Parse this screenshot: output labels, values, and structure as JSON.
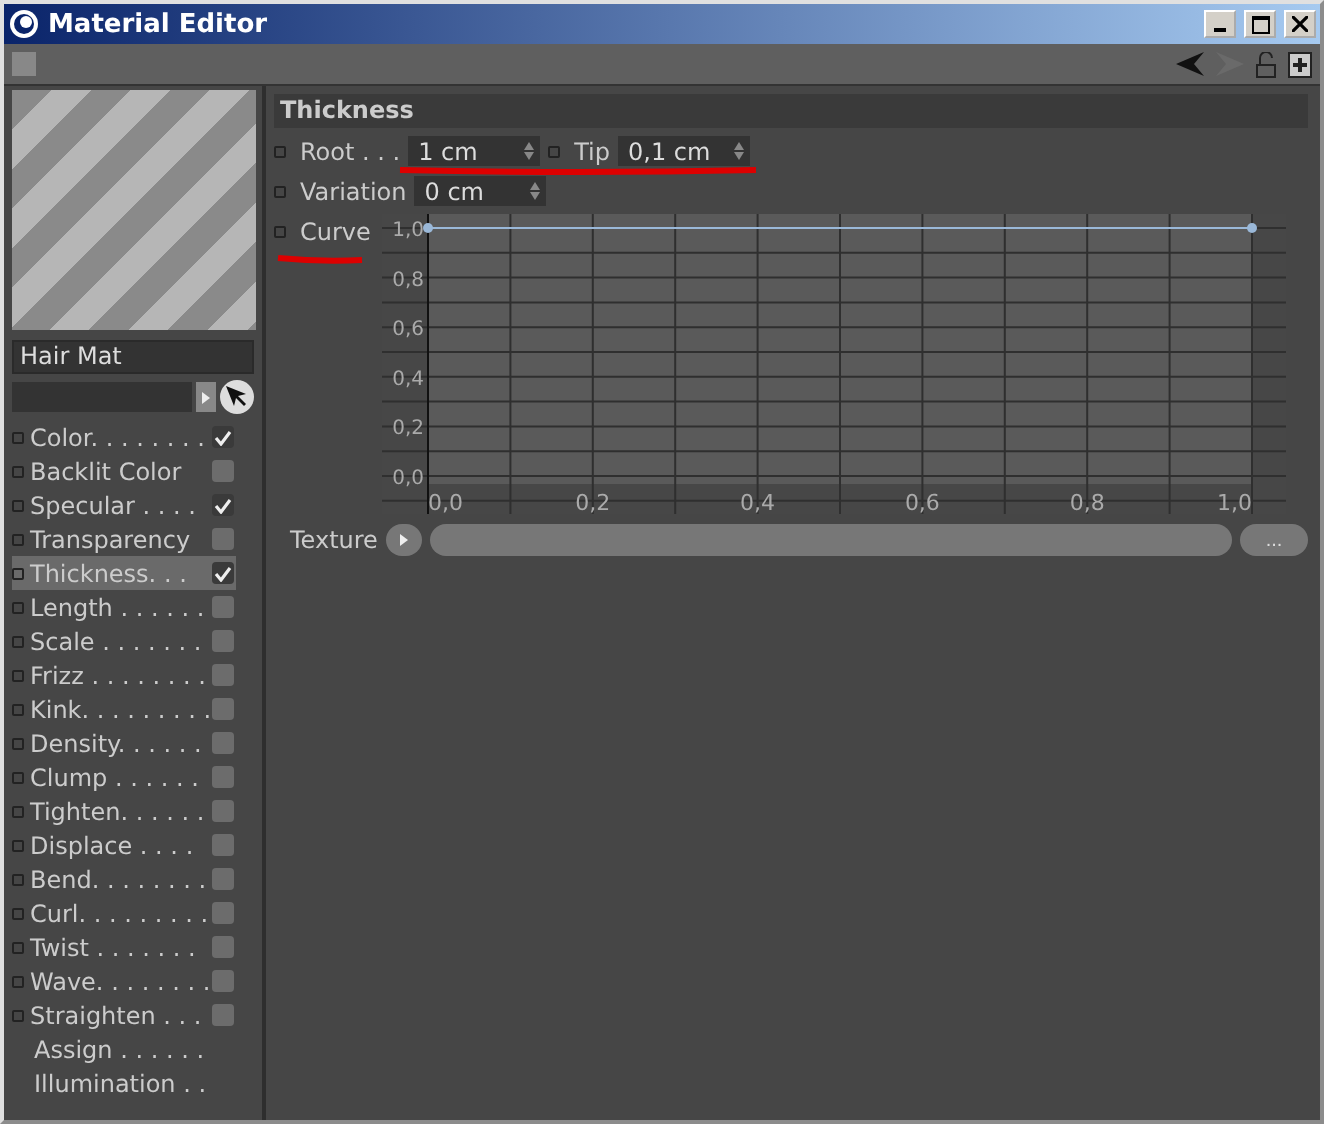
{
  "window": {
    "title": "Material Editor"
  },
  "material_name": "Hair Mat",
  "channels": [
    {
      "kind": "check",
      "label": "Color. . . . . . . .",
      "checked": true,
      "selected": false
    },
    {
      "kind": "check",
      "label": "Backlit Color",
      "checked": false,
      "selected": false
    },
    {
      "kind": "check",
      "label": "Specular . . . .",
      "checked": true,
      "selected": false
    },
    {
      "kind": "check",
      "label": "Transparency",
      "checked": false,
      "selected": false
    },
    {
      "kind": "check",
      "label": "Thickness. . .",
      "checked": true,
      "selected": true
    },
    {
      "kind": "check",
      "label": "Length . . . . . .",
      "checked": false,
      "selected": false
    },
    {
      "kind": "check",
      "label": "Scale . . . . . . .",
      "checked": false,
      "selected": false
    },
    {
      "kind": "check",
      "label": "Frizz . . . . . . . .",
      "checked": false,
      "selected": false
    },
    {
      "kind": "check",
      "label": "Kink. . . . . . . . .",
      "checked": false,
      "selected": false
    },
    {
      "kind": "check",
      "label": "Density. . . . . .",
      "checked": false,
      "selected": false
    },
    {
      "kind": "check",
      "label": "Clump . . . . . .",
      "checked": false,
      "selected": false
    },
    {
      "kind": "check",
      "label": "Tighten. . . . . .",
      "checked": false,
      "selected": false
    },
    {
      "kind": "check",
      "label": "Displace . . . .",
      "checked": false,
      "selected": false
    },
    {
      "kind": "check",
      "label": "Bend. . . . . . . .",
      "checked": false,
      "selected": false
    },
    {
      "kind": "check",
      "label": "Curl. . . . . . . . .",
      "checked": false,
      "selected": false
    },
    {
      "kind": "check",
      "label": "Twist . . . . . . .",
      "checked": false,
      "selected": false
    },
    {
      "kind": "check",
      "label": "Wave. . . . . . . .",
      "checked": false,
      "selected": false
    },
    {
      "kind": "check",
      "label": "Straighten . . .",
      "checked": false,
      "selected": false
    },
    {
      "kind": "plain",
      "label": "Assign . . . . . .",
      "selected": false
    },
    {
      "kind": "plain",
      "label": "Illumination . .",
      "selected": false
    }
  ],
  "section": {
    "title": "Thickness",
    "root": {
      "label": "Root . . .",
      "value": "1 cm"
    },
    "tip": {
      "label": "Tip",
      "value": "0,1 cm"
    },
    "variation": {
      "label": "Variation",
      "value": "0 cm"
    },
    "curve": {
      "label": "Curve",
      "chart_data": {
        "type": "line",
        "x": [
          0,
          1
        ],
        "grid": true,
        "series": [
          {
            "color": "#9ab8d8",
            "marker": true,
            "values": [
              1,
              1
            ]
          }
        ],
        "xlim": [
          0,
          1
        ],
        "ylim": [
          0,
          1
        ],
        "xticks": [
          {
            "value": 0,
            "label": "0,0"
          },
          {
            "value": 0.2,
            "label": "0,2"
          },
          {
            "value": 0.4,
            "label": "0,4"
          },
          {
            "value": 0.6,
            "label": "0,6"
          },
          {
            "value": 0.8,
            "label": "0,8"
          },
          {
            "value": 1,
            "label": "1,0"
          }
        ],
        "yticks": [
          {
            "value": 0,
            "label": "0,0"
          },
          {
            "value": 0.2,
            "label": "0,2"
          },
          {
            "value": 0.4,
            "label": "0,4"
          },
          {
            "value": 0.6,
            "label": "0,6"
          },
          {
            "value": 0.8,
            "label": "0,8"
          },
          {
            "value": 1,
            "label": "1,0"
          }
        ]
      }
    },
    "texture": {
      "label": "Texture",
      "more": "..."
    }
  }
}
